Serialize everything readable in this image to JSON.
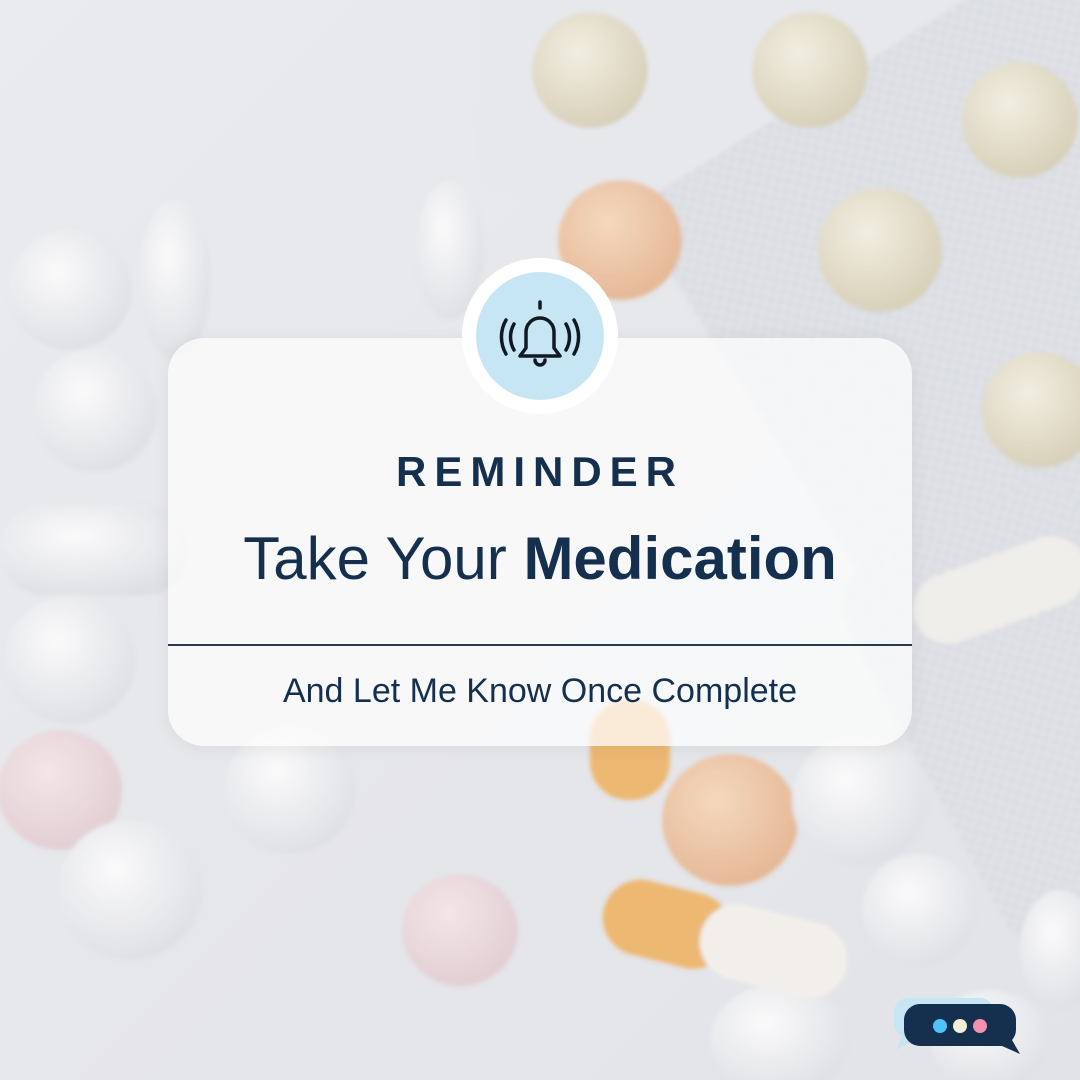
{
  "card": {
    "eyebrow": "REMINDER",
    "headline_light": "Take Your",
    "headline_bold": "Medication",
    "subtext": "And Let Me Know Once Complete"
  },
  "icons": {
    "bell": "bell-ringing-icon",
    "chat": "chat-bubble-icon"
  },
  "colors": {
    "navy": "#15304f",
    "bell_bg": "#c7e6f4",
    "dot_blue": "#4fc3f7",
    "dot_cream": "#f3efd6",
    "dot_pink": "#f48fb1"
  }
}
